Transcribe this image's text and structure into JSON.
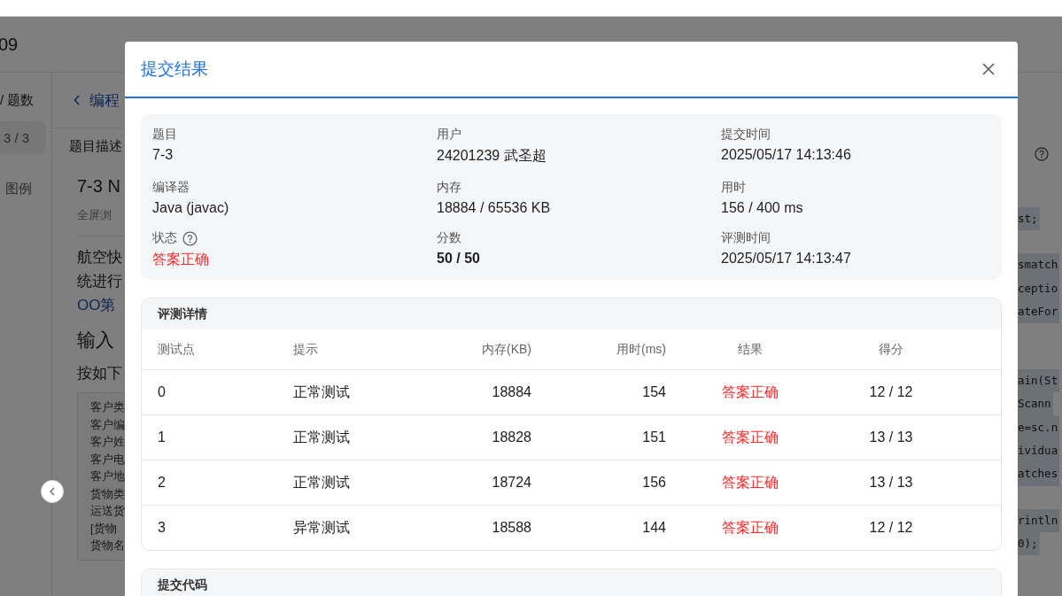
{
  "page": {
    "header_title": "09",
    "side_heading": "/ 题数",
    "side_count": "3 / 3",
    "legend": "图例",
    "back_link": "编程",
    "tab": "题目描述",
    "problem_title": "7-3 N",
    "fullscreen": "全屏浏",
    "paragraph": [
      "航空快",
      "统进行"
    ],
    "paragraph_link": "OO第",
    "section_heading": "输入",
    "instruction": "按如下",
    "sample_lines": [
      "客户类",
      "客户编",
      "客户姓",
      "客户电",
      "客户地",
      "货物类",
      "运送货",
      "[货物",
      "货物名"
    ],
    "code_blocks": [
      [
        "st;"
      ],
      [
        "smatch",
        "ceptio",
        "ateFor"
      ],
      [
        "ain(St",
        "Scann",
        "e=sc.n",
        "ividua",
        "atches"
      ],
      [
        "rintln",
        "0);"
      ]
    ]
  },
  "dialog": {
    "title": "提交结果",
    "summary": [
      {
        "label": "题目",
        "value": "7-3"
      },
      {
        "label": "用户",
        "value": "24201239 武圣超"
      },
      {
        "label": "提交时间",
        "value": "2025/05/17 14:13:46"
      },
      {
        "label": "编译器",
        "value": "Java (javac)"
      },
      {
        "label": "内存",
        "value": "18884 / 65536 KB"
      },
      {
        "label": "用时",
        "value": "156 / 400 ms"
      },
      {
        "label": "状态",
        "value": "答案正确",
        "kind": "status"
      },
      {
        "label": "分数",
        "value": "50 / 50",
        "kind": "bold"
      },
      {
        "label": "评测时间",
        "value": "2025/05/17 14:13:47"
      }
    ],
    "details": {
      "title": "评测详情",
      "columns": [
        "测试点",
        "提示",
        "内存(KB)",
        "用时(ms)",
        "结果",
        "得分"
      ],
      "rows": [
        [
          "0",
          "正常测试",
          "18884",
          "154",
          "答案正确",
          "12 / 12"
        ],
        [
          "1",
          "正常测试",
          "18828",
          "151",
          "答案正确",
          "13 / 13"
        ],
        [
          "2",
          "正常测试",
          "18724",
          "156",
          "答案正确",
          "13 / 13"
        ],
        [
          "3",
          "异常测试",
          "18588",
          "144",
          "答案正确",
          "12 / 12"
        ]
      ]
    },
    "code_section": "提交代码"
  }
}
